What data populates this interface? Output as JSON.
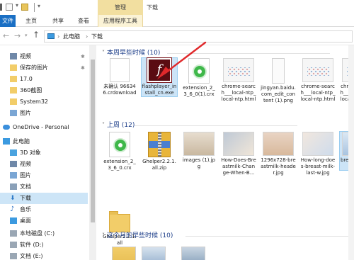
{
  "titlebar": {
    "management_tab": "管理",
    "window_title": "下载"
  },
  "ribbon": {
    "tabs": [
      "文件",
      "主页",
      "共享",
      "查看",
      "应用程序工具"
    ]
  },
  "address": {
    "crumbs": [
      "此电脑",
      "下载"
    ],
    "separator": "›"
  },
  "nav": {
    "items": [
      {
        "label": "视频",
        "icon": "video-folder-icon",
        "pinned": true
      },
      {
        "label": "保存的图片",
        "icon": "folder-icon",
        "pinned": true
      },
      {
        "label": "17.0",
        "icon": "folder-icon",
        "pinned": false
      },
      {
        "label": "360截图",
        "icon": "folder-icon",
        "pinned": false
      },
      {
        "label": "System32",
        "icon": "folder-icon",
        "pinned": false
      },
      {
        "label": "图片",
        "icon": "pictures-folder-icon",
        "pinned": false
      },
      {
        "label": "OneDrive - Personal",
        "icon": "cloud-icon",
        "pinned": false
      },
      {
        "label": "此电脑",
        "icon": "computer-icon",
        "pinned": false
      },
      {
        "label": "3D 对象",
        "icon": "objects-3d-icon",
        "pinned": false
      },
      {
        "label": "视频",
        "icon": "video-folder-icon",
        "pinned": false
      },
      {
        "label": "图片",
        "icon": "pictures-folder-icon",
        "pinned": false
      },
      {
        "label": "文档",
        "icon": "documents-folder-icon",
        "pinned": false
      },
      {
        "label": "下载",
        "icon": "download-arrow-icon",
        "pinned": false,
        "selected": true
      },
      {
        "label": "音乐",
        "icon": "music-note-icon",
        "pinned": false
      },
      {
        "label": "桌面",
        "icon": "desktop-folder-icon",
        "pinned": false
      },
      {
        "label": "本地磁盘 (C:)",
        "icon": "drive-icon",
        "pinned": false
      },
      {
        "label": "软件 (D:)",
        "icon": "drive-icon",
        "pinned": false
      },
      {
        "label": "文档 (E:)",
        "icon": "drive-icon",
        "pinned": false
      }
    ]
  },
  "groups": [
    {
      "header": "本周早些时候 (10)",
      "files": [
        {
          "name": "未确认 966346.crdownload",
          "kind": "document"
        },
        {
          "name": "flashplayer_install_cn.exe",
          "kind": "flash",
          "selected": true
        },
        {
          "name": "extension_2_3_6_0(1).crx",
          "kind": "crx"
        },
        {
          "name": "chrome-search___local-ntp_local-ntp.html",
          "kind": "thumb"
        },
        {
          "name": "jingyan.baidu.com_edit_content (1).png",
          "kind": "png"
        },
        {
          "name": "chrome-search___local-ntp_local-ntp.html",
          "kind": "thumb"
        },
        {
          "name": "chrome-search___local-ntp_local-ntp.html",
          "kind": "thumb"
        }
      ]
    },
    {
      "header": "上周 (12)",
      "files": [
        {
          "name": "extension_2_3_6_0.crx",
          "kind": "crx"
        },
        {
          "name": "Ghelper2.2.1.all.zip",
          "kind": "zip"
        },
        {
          "name": "images (1).jpg",
          "kind": "photo"
        },
        {
          "name": "How-Does-Breastmilk-Change-When-B...",
          "kind": "photo"
        },
        {
          "name": "1296x728-breastmilk-header.jpg",
          "kind": "photo"
        },
        {
          "name": "How-long-does-breast-milk-last-w.jpg",
          "kind": "photo"
        },
        {
          "name": "breast-milk.jpg",
          "kind": "photo",
          "selected": true
        },
        {
          "name": "Ghelper2.2.1.all",
          "kind": "folder"
        }
      ]
    },
    {
      "header": "这个月的早些时候 (10)",
      "files": []
    }
  ],
  "colors": {
    "accent": "#1a6fc4",
    "group_header": "#1e3f8a",
    "selection": "#cce4f7",
    "management_tab": "#f2dfa0",
    "annotation_arrow": "#e0292b"
  }
}
